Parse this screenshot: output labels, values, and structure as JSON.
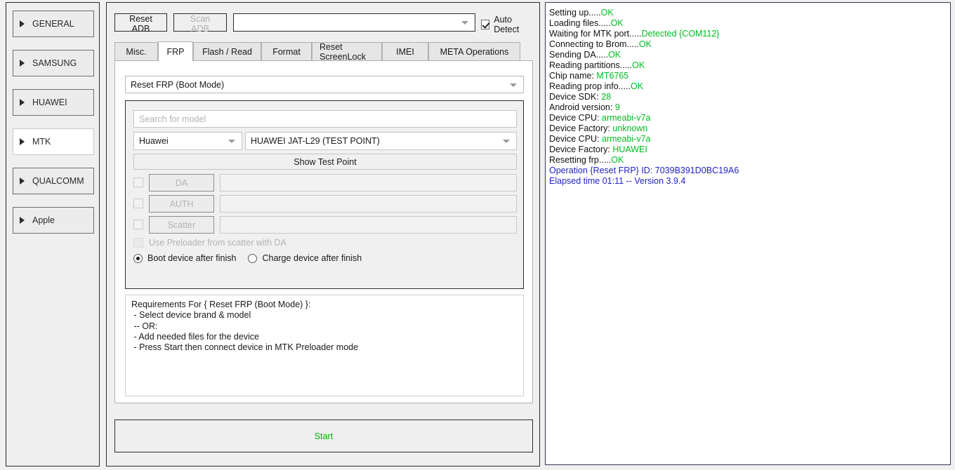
{
  "sidebar": {
    "items": [
      {
        "label": "GENERAL",
        "selected": false
      },
      {
        "label": "SAMSUNG",
        "selected": false
      },
      {
        "label": "HUAWEI",
        "selected": false
      },
      {
        "label": "MTK",
        "selected": true
      },
      {
        "label": "QUALCOMM",
        "selected": false
      },
      {
        "label": "Apple",
        "selected": false
      }
    ]
  },
  "toolbar": {
    "reset_adb_label": "Reset ADB",
    "scan_adb_label": "Scan ADB",
    "adb_combo_value": "",
    "auto_detect_label": "Auto Detect",
    "auto_detect_checked": true
  },
  "tabs": [
    {
      "label": "Misc.",
      "active": false
    },
    {
      "label": "FRP",
      "active": true
    },
    {
      "label": "Flash / Read",
      "active": false
    },
    {
      "label": "Format",
      "active": false
    },
    {
      "label": "Reset ScreenLock",
      "active": false
    },
    {
      "label": "IMEI",
      "active": false
    },
    {
      "label": "META Operations",
      "active": false
    }
  ],
  "frp": {
    "mode_value": "Reset FRP (Boot Mode)",
    "search_placeholder": "Search for model",
    "search_value": "",
    "brand_value": "Huawei",
    "model_value": "HUAWEI JAT-L29 (TEST POINT)",
    "show_test_point_label": "Show Test Point",
    "file_rows": [
      {
        "button_label": "DA",
        "value": "",
        "checked": false
      },
      {
        "button_label": "AUTH",
        "value": "",
        "checked": false
      },
      {
        "button_label": "Scatter",
        "value": "",
        "checked": false
      }
    ],
    "preloader_label": "Use Preloader from scatter with DA",
    "preloader_checked": false,
    "boot_after_finish_label": "Boot device after finish",
    "charge_after_finish_label": "Charge device after finish",
    "finish_selected": "boot",
    "requirements_text": "Requirements For { Reset FRP (Boot Mode) }:\n - Select device brand & model\n -- OR:\n - Add needed files for the device\n - Press Start then connect device in MTK Preloader mode",
    "start_label": "Start"
  },
  "log": {
    "lines": [
      [
        {
          "t": "Setting up.....",
          "c": "k"
        },
        {
          "t": "OK",
          "c": "g"
        }
      ],
      [
        {
          "t": "Loading files.....",
          "c": "k"
        },
        {
          "t": "OK",
          "c": "g"
        }
      ],
      [
        {
          "t": "Waiting for MTK port.....",
          "c": "k"
        },
        {
          "t": "Detected {COM112}",
          "c": "g"
        }
      ],
      [
        {
          "t": "Connecting to Brom.....",
          "c": "k"
        },
        {
          "t": "OK",
          "c": "g"
        }
      ],
      [
        {
          "t": "Sending DA.....",
          "c": "k"
        },
        {
          "t": "OK",
          "c": "g"
        }
      ],
      [
        {
          "t": "Reading partitions.....",
          "c": "k"
        },
        {
          "t": "OK",
          "c": "g"
        }
      ],
      [
        {
          "t": "Chip name: ",
          "c": "k"
        },
        {
          "t": "MT6765",
          "c": "g"
        }
      ],
      [
        {
          "t": "Reading prop info.....",
          "c": "k"
        },
        {
          "t": "OK",
          "c": "g"
        }
      ],
      [
        {
          "t": "Device SDK: ",
          "c": "k"
        },
        {
          "t": "28",
          "c": "g"
        }
      ],
      [
        {
          "t": "Android version: ",
          "c": "k"
        },
        {
          "t": "9",
          "c": "g"
        }
      ],
      [
        {
          "t": "Device CPU: ",
          "c": "k"
        },
        {
          "t": "armeabi-v7a",
          "c": "g"
        }
      ],
      [
        {
          "t": "Device Factory: ",
          "c": "k"
        },
        {
          "t": "unknown",
          "c": "g"
        }
      ],
      [
        {
          "t": "Device CPU: ",
          "c": "k"
        },
        {
          "t": "armeabi-v7a",
          "c": "g"
        }
      ],
      [
        {
          "t": "Device Factory: ",
          "c": "k"
        },
        {
          "t": "HUAWEI",
          "c": "g"
        }
      ],
      [
        {
          "t": "Resetting frp.....",
          "c": "k"
        },
        {
          "t": "OK",
          "c": "g"
        }
      ],
      [
        {
          "t": "Operation {Reset FRP} ID: 7039B391D0BC19A6",
          "c": "b"
        }
      ],
      [
        {
          "t": "Elapsed time 01:11 -- Version 3.9.4",
          "c": "b"
        }
      ]
    ]
  },
  "colors": {
    "success_green": "#00bb22",
    "info_blue": "#2222cc",
    "start_green": "#00b200",
    "panel_border": "#2b2b2b",
    "log_border": "#33384f"
  }
}
